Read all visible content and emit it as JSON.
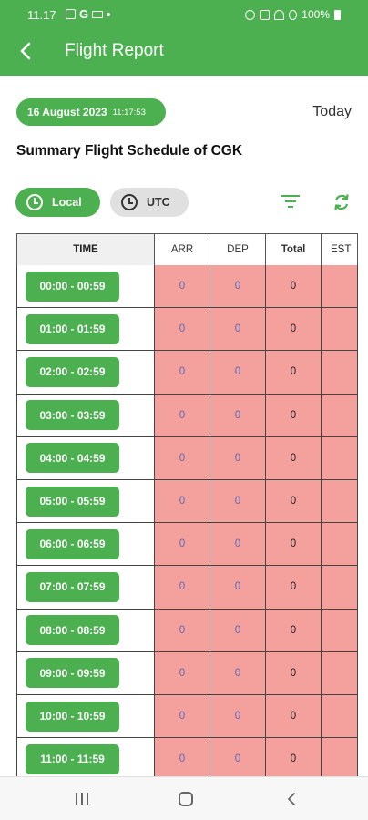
{
  "status_bar": {
    "time": "11.17",
    "g_label": "G",
    "battery_text": "100%"
  },
  "app_bar": {
    "title": "Flight Report",
    "back_icon": "back-arrow-icon"
  },
  "date_pill": {
    "date": "16 August 2023",
    "time": "11:17:53"
  },
  "today_label": "Today",
  "summary_title": "Summary Flight Schedule of CGK",
  "toggles": {
    "local_label": "Local",
    "utc_label": "UTC",
    "selected": "Local"
  },
  "colors": {
    "primary": "#4caf50",
    "cell_background": "#f4a09c",
    "link_value": "#5b6bb7"
  },
  "table": {
    "headers": [
      "TIME",
      "ARR",
      "DEP",
      "Total",
      "EST"
    ],
    "rows": [
      {
        "time": "00:00 - 00:59",
        "arr": "0",
        "dep": "0",
        "total": "0"
      },
      {
        "time": "01:00 - 01:59",
        "arr": "0",
        "dep": "0",
        "total": "0"
      },
      {
        "time": "02:00 - 02:59",
        "arr": "0",
        "dep": "0",
        "total": "0"
      },
      {
        "time": "03:00 - 03:59",
        "arr": "0",
        "dep": "0",
        "total": "0"
      },
      {
        "time": "04:00 - 04:59",
        "arr": "0",
        "dep": "0",
        "total": "0"
      },
      {
        "time": "05:00 - 05:59",
        "arr": "0",
        "dep": "0",
        "total": "0"
      },
      {
        "time": "06:00 - 06:59",
        "arr": "0",
        "dep": "0",
        "total": "0"
      },
      {
        "time": "07:00 - 07:59",
        "arr": "0",
        "dep": "0",
        "total": "0"
      },
      {
        "time": "08:00 - 08:59",
        "arr": "0",
        "dep": "0",
        "total": "0"
      },
      {
        "time": "09:00 - 09:59",
        "arr": "0",
        "dep": "0",
        "total": "0"
      },
      {
        "time": "10:00 - 10:59",
        "arr": "0",
        "dep": "0",
        "total": "0"
      },
      {
        "time": "11:00 - 11:59",
        "arr": "0",
        "dep": "0",
        "total": "0"
      }
    ]
  }
}
